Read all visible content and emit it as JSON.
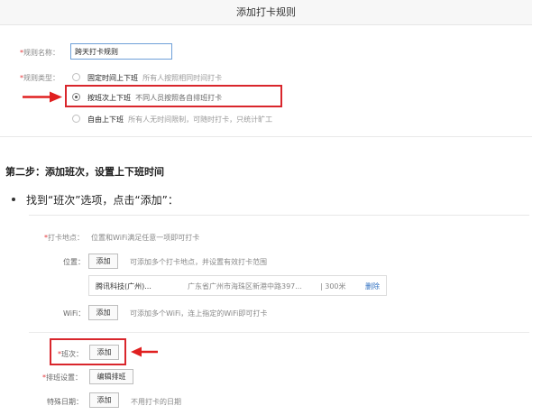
{
  "header": {
    "title": "添加打卡规则"
  },
  "rule_name": {
    "required_mark": "*",
    "label": "规则名称：",
    "value": "跨天打卡规则"
  },
  "rule_type": {
    "required_mark": "*",
    "label": "规则类型：",
    "options": [
      {
        "title": "固定时间上下班",
        "desc": "所有人按照相同时间打卡",
        "selected": false
      },
      {
        "title": "按班次上下班",
        "desc": "不同人员按照各自排班打卡",
        "selected": true
      },
      {
        "title": "自由上下班",
        "desc": "所有人无时间限制，可随时打卡，只统计旷工",
        "selected": false
      }
    ]
  },
  "step": {
    "title": "第二步：添加班次，设置上下班时间",
    "instruction": "找到“班次”选项，点击“添加”："
  },
  "form": {
    "location": {
      "required_mark": "*",
      "label": "打卡地点：",
      "hint": "位置和WiFi满足任意一项即可打卡"
    },
    "position": {
      "label": "位置：",
      "button": "添加",
      "hint": "可添加多个打卡地点，并设置有效打卡范围",
      "row": {
        "name": "腾讯科技(广州)...",
        "address": "广东省广州市海珠区新港中路397...",
        "range": "| 300米",
        "action": "删除"
      }
    },
    "wifi": {
      "label": "WiFi：",
      "button": "添加",
      "hint": "可添加多个WiFi，连上指定的WiFi即可打卡"
    },
    "shift": {
      "required_mark": "*",
      "label": "班次：",
      "button": "添加"
    },
    "schedule": {
      "required_mark": "*",
      "label": "排班设置：",
      "button": "编辑排班"
    },
    "special_date": {
      "label": "特殊日期：",
      "button": "添加",
      "hint": "不用打卡的日期"
    }
  },
  "colors": {
    "highlight": "#d9262c",
    "delete_link": "#2f6fc0",
    "input_border": "#6ea0d8"
  }
}
